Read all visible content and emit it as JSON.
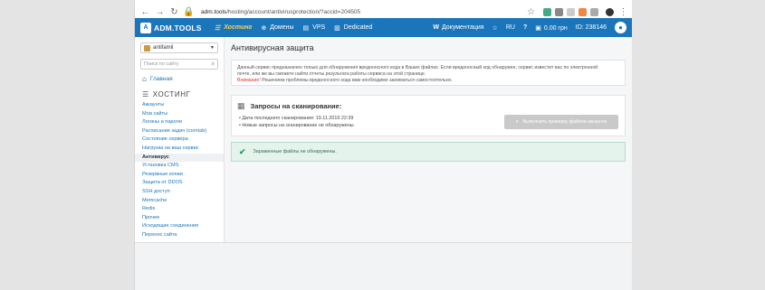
{
  "browser": {
    "url_host": "adm.tools",
    "url_path": "/hosting/account/antivirusprotection/?accid=204505"
  },
  "topnav": {
    "logo_text": "ADM.TOOLS",
    "items": [
      {
        "label": "Хостинг",
        "icon": "server-icon"
      },
      {
        "label": "Домены",
        "icon": "globe-icon"
      },
      {
        "label": "VPS",
        "icon": "vps-icon"
      },
      {
        "label": "Dedicated",
        "icon": "dedicated-icon"
      }
    ],
    "docs": "Документация",
    "lang": "RU",
    "balance": "0.00 грн",
    "account_id": "ID: 238146"
  },
  "sidebar": {
    "account": "antifamil",
    "search_placeholder": "Поиск по сайту",
    "home": "Главная",
    "section": "ХОСТИНГ",
    "items": [
      "Аккаунты",
      "Мои сайты",
      "Логины и пароли",
      "Расписание задач (crontab)",
      "Состояние сервера",
      "Нагрузка на ваш сервис",
      "Антивирус",
      "Установка CMS",
      "Резервные копии",
      "Защита от DDOS",
      "SSH доступ",
      "Memcache",
      "Redis",
      "Прочее",
      "Исходящие соединения",
      "Перенос сайта"
    ],
    "active_index": 6
  },
  "main": {
    "title": "Антивирусная защита",
    "notice_1": "Данный сервис предназначен только для обнаружения вредоносного кода в Ваших файлах. Если вредоносный код обнаружен, сервис известит вас по электронной",
    "notice_2": "почте, или же вы сможете найти отчеты результата работы сервиса на этой странице.",
    "notice_warn": "Внимание!",
    "notice_3": " Решением проблемы вредоносного кода вам необходимо заниматься самостоятельно.",
    "scan_title": "Запросы на сканирование:",
    "scan_items": [
      "Дата последнего сканирования: 19.11.2019 22:39",
      "Новые запросы на сканирование не обнаружены"
    ],
    "scan_button": "Выполнить проверку файлов аккаунта",
    "result": "Зараженные файлы не обнаружены."
  }
}
